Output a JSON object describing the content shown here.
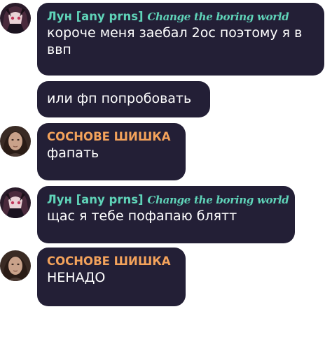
{
  "messages": [
    {
      "author": "Лун [any prns]",
      "author_tag": "Change the boring world",
      "lines": [
        "короче меня заебал 2ос поэтому я в",
        "ввп"
      ]
    },
    {
      "lines": [
        "или фп попробовать"
      ]
    },
    {
      "author": "СОСНОВЕ ШИШКА",
      "lines": [
        "фапать"
      ]
    },
    {
      "author": "Лун [any prns]",
      "author_tag": "Change the boring world",
      "lines": [
        "щас я тебе пофапаю блятт"
      ]
    },
    {
      "author": "СОСНОВЕ ШИШКА",
      "lines": [
        "НЕНАДО"
      ]
    }
  ],
  "colors": {
    "bubble_bg": "#231f36",
    "name_luna": "#5fd3b8",
    "name_shishka": "#f3a25b",
    "text": "#ffffff"
  },
  "icons": {
    "luna_avatar": "anime-avatar-icon",
    "shishka_avatar": "portrait-avatar-icon"
  }
}
